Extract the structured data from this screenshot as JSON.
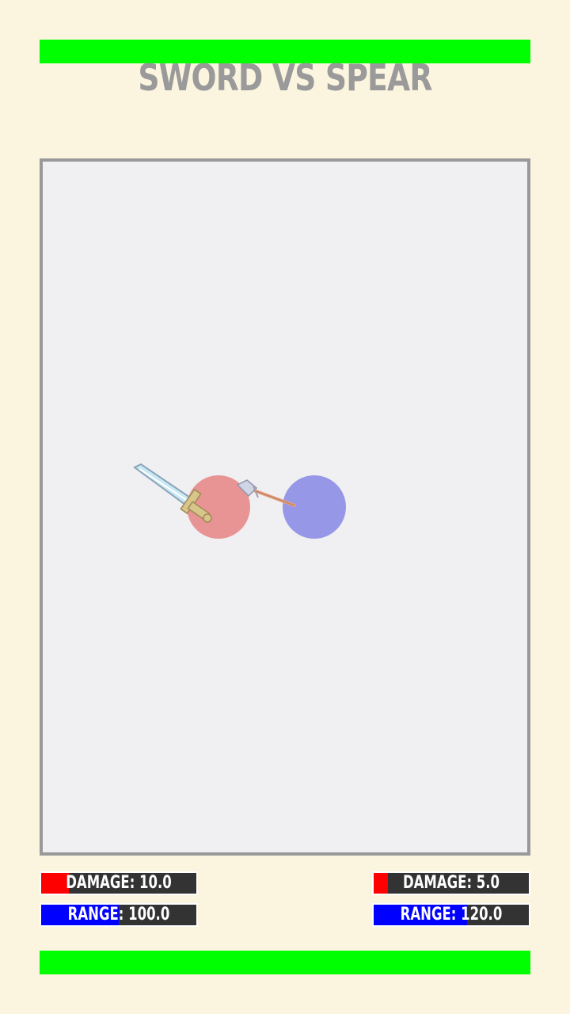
{
  "game": {
    "title": "SWORD VS SPEAR"
  },
  "health": {
    "top": 1.0,
    "bottom": 1.0
  },
  "player1": {
    "weapon": "sword-icon",
    "color": "#e89494",
    "damage_label": "DAMAGE: 10.0",
    "range_label": "RANGE: 100.0",
    "damage_fill": 0.18,
    "range_fill": 0.5
  },
  "player2": {
    "weapon": "spear-icon",
    "color": "#9797e8",
    "damage_label": "DAMAGE: 5.0",
    "range_label": "RANGE: 120.0",
    "damage_fill": 0.09,
    "range_fill": 0.6
  },
  "colors": {
    "health": "#00ff00",
    "damage": "#ff0000",
    "range": "#0000ff",
    "background": "#fbf4df",
    "arena": "#f0eff1"
  }
}
